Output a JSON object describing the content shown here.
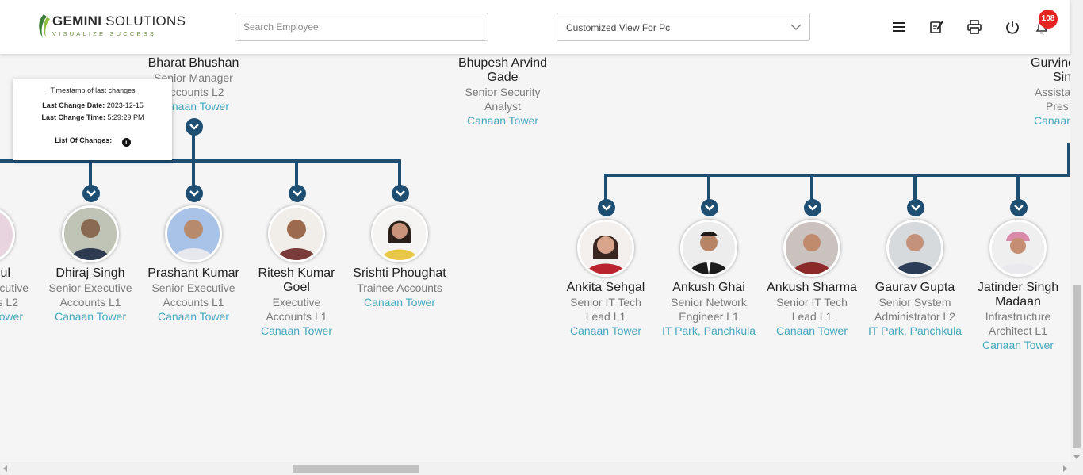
{
  "header": {
    "logo_word1": "GEMINI",
    "logo_word2": "SOLUTIONS",
    "logo_tagline": "VISUALIZE SUCCESS",
    "search_placeholder": "Search Employee",
    "view_select_value": "Customized View For Pc",
    "notification_count": "108",
    "icons": [
      "menu-icon",
      "edit-note-icon",
      "print-icon",
      "power-icon",
      "bell-icon"
    ]
  },
  "tooltip": {
    "title": "Timestamp of last changes",
    "date_label": "Last Change Date:",
    "date_value": "2023-12-15",
    "time_label": "Last Change Time:",
    "time_value": "5:29:29 PM",
    "changes_label": "List Of Changes:"
  },
  "managers": [
    {
      "name": "Bharat Bhushan",
      "role_lines": [
        "Senior Manager",
        "Accounts L2"
      ],
      "location": "Canaan Tower"
    },
    {
      "name": "Bhupesh Arvind Gade",
      "name_lines": [
        "Bhupesh Arvind",
        "Gade"
      ],
      "role_lines": [
        "Senior Security",
        "Analyst"
      ],
      "location": "Canaan Tower"
    },
    {
      "name": "Gurvinder Singh",
      "name_lines": [
        "Gurvind",
        "Sin"
      ],
      "role_lines": [
        "Assista",
        "Pres"
      ],
      "location": "Canaan"
    }
  ],
  "left_team": [
    {
      "name_lines": [
        "ul"
      ],
      "role_lines": [
        "ecutive",
        "s L2"
      ],
      "location": "ower"
    },
    {
      "name_lines": [
        "Dhiraj Singh"
      ],
      "role_lines": [
        "Senior Executive",
        "Accounts L1"
      ],
      "location": "Canaan Tower"
    },
    {
      "name_lines": [
        "Prashant Kumar"
      ],
      "role_lines": [
        "Senior Executive",
        "Accounts L1"
      ],
      "location": "Canaan Tower"
    },
    {
      "name_lines": [
        "Ritesh Kumar",
        "Goel"
      ],
      "role_lines": [
        "Executive",
        "Accounts L1"
      ],
      "location": "Canaan Tower"
    },
    {
      "name_lines": [
        "Srishti Phoughat"
      ],
      "role_lines": [
        "Trainee Accounts"
      ],
      "location": "Canaan Tower"
    }
  ],
  "right_team": [
    {
      "name_lines": [
        "Ankita Sehgal"
      ],
      "role_lines": [
        "Senior IT Tech",
        "Lead L1"
      ],
      "location": "Canaan Tower"
    },
    {
      "name_lines": [
        "Ankush Ghai"
      ],
      "role_lines": [
        "Senior Network",
        "Engineer L1"
      ],
      "location": "IT Park, Panchkula"
    },
    {
      "name_lines": [
        "Ankush Sharma"
      ],
      "role_lines": [
        "Senior IT Tech",
        "Lead L1"
      ],
      "location": "Canaan Tower"
    },
    {
      "name_lines": [
        "Gaurav Gupta"
      ],
      "role_lines": [
        "Senior System",
        "Administrator L2"
      ],
      "location": "IT Park, Panchkula"
    },
    {
      "name_lines": [
        "Jatinder Singh",
        "Madaan"
      ],
      "role_lines": [
        "Infrastructure",
        "Architect L1"
      ],
      "location": "Canaan Tower"
    }
  ],
  "colors": {
    "connector": "#1f4e73",
    "location_link": "#45a8c0",
    "badge": "#e52521"
  }
}
